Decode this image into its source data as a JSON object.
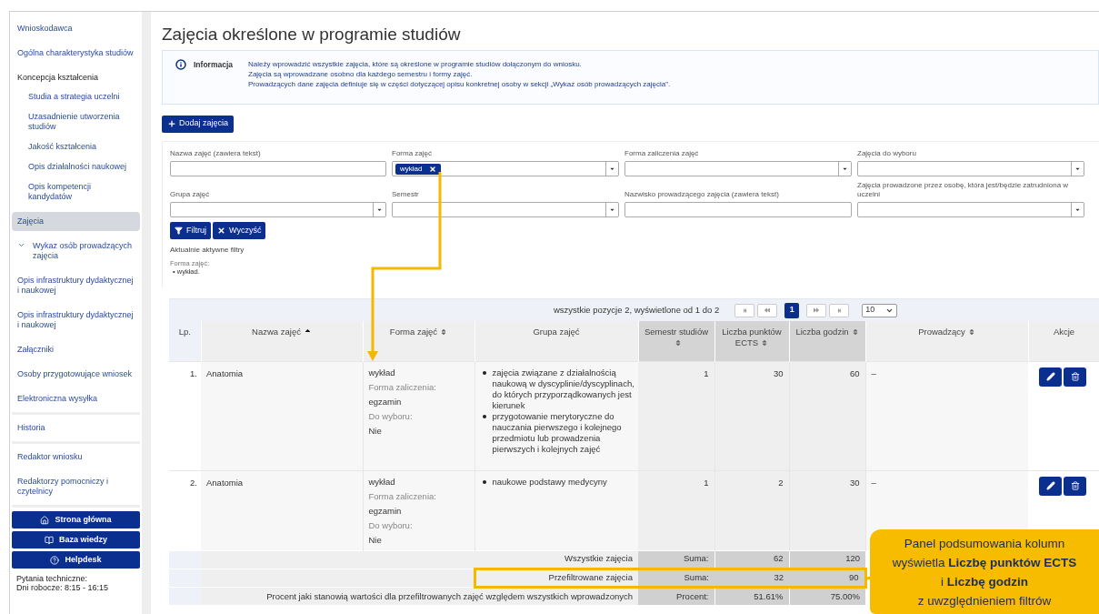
{
  "sidebar": {
    "groups": [
      {
        "items": [
          {
            "label": "Wnioskodawca",
            "kind": "link",
            "selected": false
          },
          {
            "label": "Ogólna charakterystyka studiów",
            "kind": "link",
            "selected": false
          },
          {
            "label": "Koncepcja kształcenia",
            "kind": "heading",
            "selected": false,
            "children": [
              {
                "label": "Studia a strategia uczelni",
                "kind": "link",
                "selected": false
              },
              {
                "label": "Uzasadnienie utworzenia studiów",
                "kind": "link",
                "selected": false
              },
              {
                "label": "Jakość kształcenia",
                "kind": "link",
                "selected": false
              },
              {
                "label": "Opis działalności naukowej",
                "kind": "link",
                "selected": false
              },
              {
                "label": "Opis kompetencji kandydatów",
                "kind": "link",
                "selected": false
              }
            ]
          },
          {
            "label": "Zajęcia",
            "kind": "link",
            "selected": true
          },
          {
            "label": "Wykaz osób prowadzących zajęcia",
            "kind": "toggle",
            "expanded": false,
            "selected": false
          },
          {
            "label": "Opis infrastruktury dydaktycznej i naukowej",
            "kind": "link",
            "selected": false
          },
          {
            "label": "Opis infrastruktury dydaktycznej i naukowej",
            "kind": "link",
            "selected": false
          },
          {
            "label": "Załączniki",
            "kind": "link",
            "selected": false
          },
          {
            "label": "Osoby przygotowujące wniosek",
            "kind": "link",
            "selected": false
          },
          {
            "label": "Elektroniczna wysyłka",
            "kind": "link",
            "selected": false
          }
        ]
      },
      {
        "items": [
          {
            "label": "Historia",
            "kind": "link",
            "selected": false
          }
        ]
      },
      {
        "items": [
          {
            "label": "Redaktor wniosku",
            "kind": "link",
            "selected": false
          },
          {
            "label": "Redaktorzy pomocniczy i czytelnicy",
            "kind": "link",
            "selected": false
          }
        ]
      }
    ],
    "buttons": [
      {
        "label": "Strona główna",
        "kind": "home"
      },
      {
        "label": "Baza wiedzy",
        "kind": "book"
      },
      {
        "label": "Helpdesk",
        "kind": "help"
      }
    ],
    "footer": [
      "Pytania techniczne:",
      "Dni robocze: 8:15 - 16:15"
    ]
  },
  "page": {
    "title": "Zajęcia określone w programie studiów",
    "info": {
      "label": "Informacja",
      "lines": [
        "Należy wprowadzić wszystkie zajęcia, które są określone w programie studiów dołączonym do wniosku.",
        "Zajęcia są wprowadzane osobno dla każdego semestru i formy zajęć.",
        "Prowadzących dane zajęcia definiuje się w części dotyczącej opisu konkretnej osoby w sekcji „Wykaz osób prowadzących zajęcia”."
      ]
    },
    "add_button": "Dodaj zajęcia",
    "filters": [
      {
        "label": "Nazwa zajęć (zawiera tekst)",
        "kind": "text"
      },
      {
        "label": "Forma zajęć",
        "kind": "select",
        "chips": [
          "wykład"
        ]
      },
      {
        "label": "Forma zaliczenia zajęć",
        "kind": "select"
      },
      {
        "label": "Zajęcia do wyboru",
        "kind": "select"
      },
      {
        "label": "Grupa zajęć",
        "kind": "select"
      },
      {
        "label": "Semestr",
        "kind": "select"
      },
      {
        "label": "Nazwisko prowadzącego zajęcia (zawiera tekst)",
        "kind": "text"
      },
      {
        "label": "Zajęcia prowadzone przez osobę, która jest/będzie zatrudniona w uczelni",
        "kind": "select"
      }
    ],
    "filter_buttons": [
      {
        "label": "Filtruj",
        "kind": "filter"
      },
      {
        "label": "Wyczyść",
        "kind": "clear"
      }
    ],
    "active_filters": {
      "title": "Aktualnie aktywne filtry",
      "groups": [
        {
          "label": "Forma zajęć:",
          "values": [
            "• wykład."
          ]
        }
      ]
    },
    "table": {
      "summary": "wszystkie pozycje 2, wyświetlone od 1 do 2",
      "pages": [
        {
          "label": "1",
          "selected": true
        }
      ],
      "page_size": "10",
      "columns": [
        {
          "label": "Lp.",
          "sortable": false,
          "sorted": false,
          "highlighted": false
        },
        {
          "label": "Nazwa zajęć",
          "sortable": true,
          "sorted": true,
          "highlighted": false
        },
        {
          "label": "Forma zajęć",
          "sortable": true,
          "sorted": false,
          "highlighted": false
        },
        {
          "label": "Grupa zajęć",
          "sortable": false,
          "sorted": false,
          "highlighted": false
        },
        {
          "label": "Semestr studiów",
          "sortable": true,
          "sorted": false,
          "highlighted": true
        },
        {
          "label": "Liczba punktów ECTS",
          "sortable": true,
          "sorted": false,
          "highlighted": true
        },
        {
          "label": "Liczba godzin",
          "sortable": true,
          "sorted": false,
          "highlighted": true
        },
        {
          "label": "Prowadzący",
          "sortable": true,
          "sorted": false,
          "highlighted": false
        },
        {
          "label": "Akcje",
          "sortable": false,
          "sorted": false,
          "highlighted": false
        }
      ],
      "rows": [
        {
          "lp": "1.",
          "name": "Anatomia",
          "form": "wykład",
          "credit_label": "Forma zaliczenia:",
          "credit": "egzamin",
          "elective_label": "Do wyboru:",
          "elective": "Nie",
          "groups": [
            "zajęcia związane z działalnością naukową w dyscyplinie/dyscyplinach, do których przyporządkowanych jest kierunek",
            "przygotowanie merytoryczne do nauczania pierwszego i kolejnego przedmiotu lub prowadzenia pierwszych i kolejnych zajęć"
          ],
          "semester": "1",
          "ects": "30",
          "hours": "60",
          "teacher": "–"
        },
        {
          "lp": "2.",
          "name": "Anatomia",
          "form": "wykład",
          "credit_label": "Forma zaliczenia:",
          "credit": "egzamin",
          "elective_label": "Do wyboru:",
          "elective": "Nie",
          "groups": [
            "naukowe podstawy medycyny"
          ],
          "semester": "1",
          "ects": "2",
          "hours": "30",
          "teacher": "–"
        }
      ],
      "totals": [
        {
          "label": "Wszystkie zajęcia",
          "unit": "Suma:",
          "ects": "62",
          "hours": "120",
          "highlighted": false
        },
        {
          "label": "Przefiltrowane zajęcia",
          "unit": "Suma:",
          "ects": "32",
          "hours": "90",
          "highlighted": true
        },
        {
          "label": "Procent jaki stanowią wartości dla przefiltrowanych zajęć względem wszystkich wprowadzonych",
          "unit": "Procent:",
          "ects": "51.61%",
          "hours": "75.00%",
          "highlighted": false
        }
      ]
    }
  },
  "callout": {
    "lines": [
      "Panel podsumowania kolumn",
      "wyświetla **Liczbę punktów ECTS**",
      "i **Liczbę godzin**",
      "z uwzględnieniem filtrów"
    ]
  }
}
